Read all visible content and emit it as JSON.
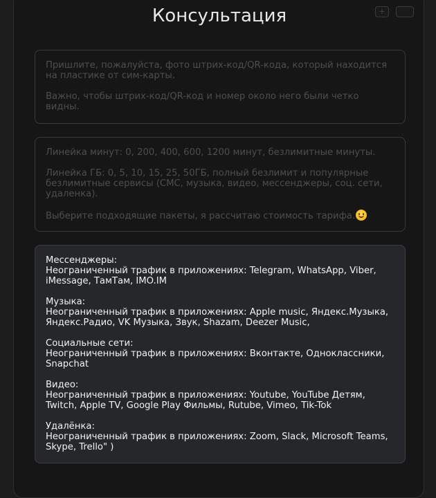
{
  "header": {
    "title": "Консультация",
    "button_a": "+",
    "button_b": ""
  },
  "messages": {
    "m1": {
      "p1": "Пришлите, пожалуйста, фото штрих-код/QR-кода, который находится на пластике от сим-карты.",
      "p2": "Важно, чтобы штрих-код/QR-код и номер около него были четко видны."
    },
    "m2": {
      "p1": "Линейка минут: 0, 200, 400, 600, 1200 минут, безлимитные минуты.",
      "p2": "Линейка ГБ: 0, 5, 10, 15, 25, 50ГБ, полный безлимит и популярные безлимитные сервисы (СМС, музыка, видео, мессенджеры, соц. сети, удаленка).",
      "p3": "Выберите подходящие пакеты, я рассчитаю стоимость тарифа.",
      "emoji_icon": "smiling-face-emoji"
    },
    "m3": {
      "sections": [
        {
          "title": "Мессенджеры:",
          "text": "Неограниченный трафик в приложениях: Telegram, WhatsApp, Viber, iMessage, ТамТам, IMO.IM"
        },
        {
          "title": "Музыка:",
          "text": "Неограниченный трафик в приложениях: Apple music, Яндекс.Музыка, Яндекс.Радио, VK Музыка, Звук, Shazam, Deezer Music,"
        },
        {
          "title": "Социальные сети:",
          "text": "Неограниченный трафик в приложениях: Вконтакте, Одноклассники, Snapchat"
        },
        {
          "title": "Видео:",
          "text": "Неограниченный трафик в приложениях: Youtube, YouTube Детям, Twitch, Apple TV, Google Play Фильмы, Rutube, Vimeo, Tik-Tok"
        },
        {
          "title": "Удалёнка:",
          "text": "Неограниченный трафик в приложениях: Zoom, Slack, Microsoft Teams, Skype, Trello\" )"
        }
      ]
    }
  }
}
